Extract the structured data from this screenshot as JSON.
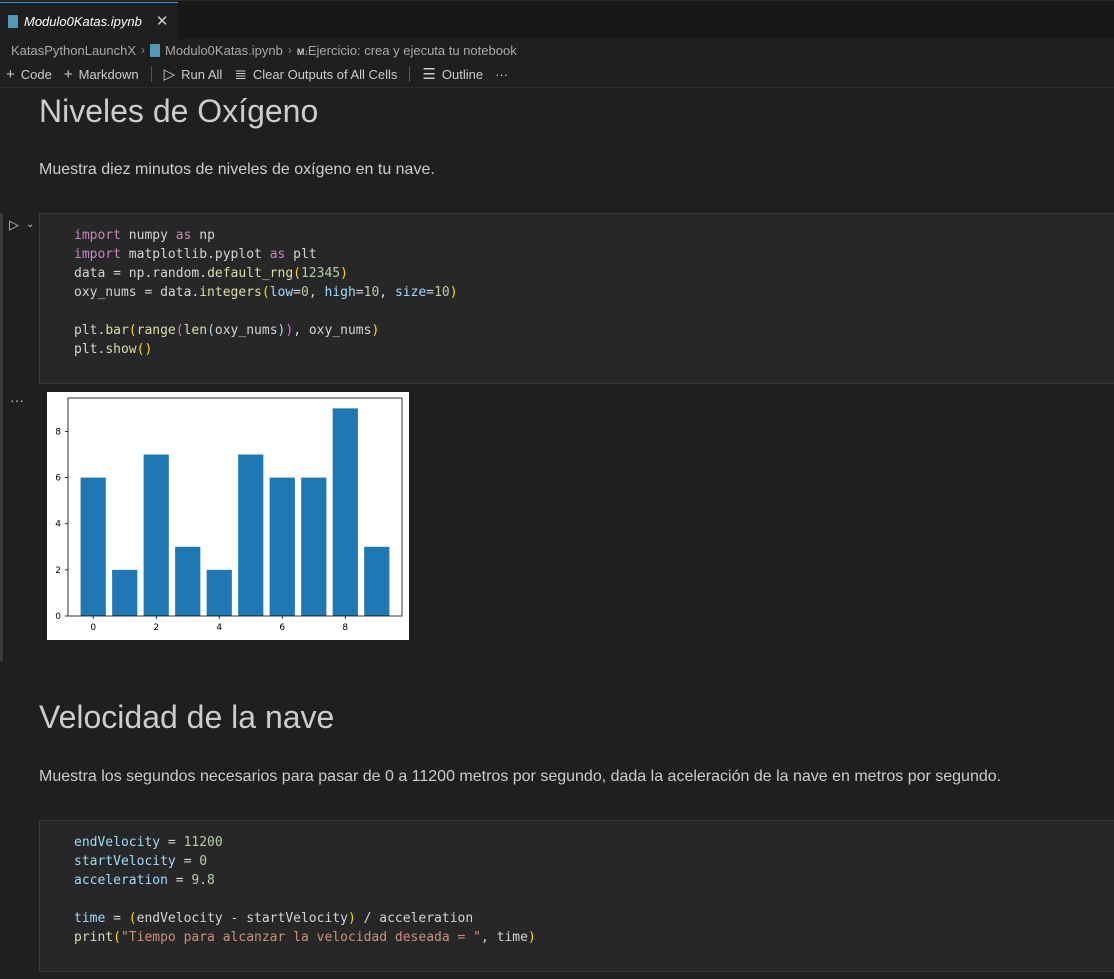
{
  "tab": {
    "title": "Modulo0Katas.ipynb",
    "close": "✕"
  },
  "breadcrumb": {
    "root": "KatasPythonLaunchX",
    "file": "Modulo0Katas.ipynb",
    "md_badge": "M↓",
    "section": "Ejercicio: crea y ejecuta tu notebook"
  },
  "toolbar": {
    "code": "Code",
    "markdown": "Markdown",
    "run_all": "Run All",
    "clear": "Clear Outputs of All Cells",
    "outline": "Outline",
    "more": "···"
  },
  "cells": {
    "h1_oxygen": "Niveles de Oxígeno",
    "p_oxygen": "Muestra diez minutos de niveles de oxígeno en tu nave.",
    "h1_velocity": "Velocidad de la nave",
    "p_velocity": "Muestra los segundos necesarios para pasar de 0 a 11200 metros por segundo, dada la aceleración de la nave en metros por segundo."
  },
  "chart_data": {
    "type": "bar",
    "x": [
      0,
      1,
      2,
      3,
      4,
      5,
      6,
      7,
      8,
      9
    ],
    "values": [
      6,
      2,
      7,
      3,
      2,
      7,
      6,
      6,
      9,
      3
    ],
    "xticks": [
      "0",
      "2",
      "4",
      "6",
      "8"
    ],
    "yticks": [
      "0",
      "2",
      "4",
      "6",
      "8"
    ],
    "color": "#1f77b4"
  }
}
